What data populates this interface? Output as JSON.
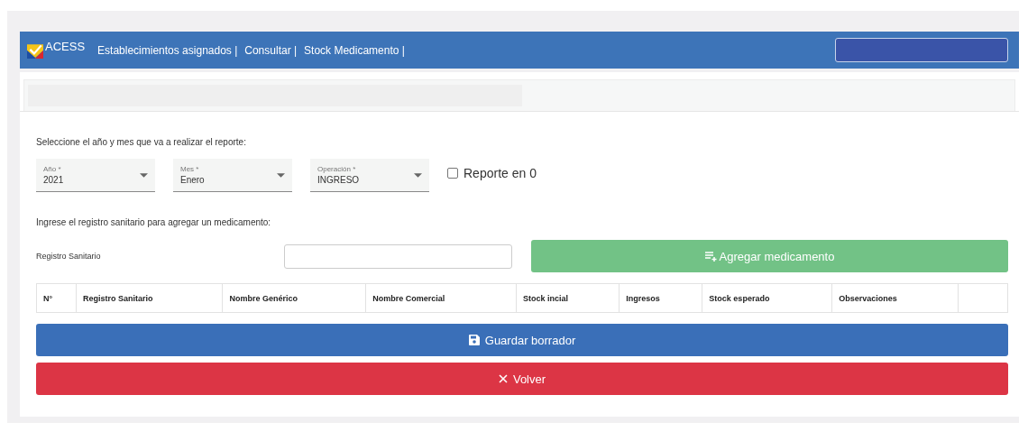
{
  "navbar": {
    "brand": "ACESS",
    "links": [
      "Establecimientos asignados |",
      "Consultar |",
      "Stock Medicamento |"
    ]
  },
  "report_form": {
    "prompt": "Seleccione el año y mes que va a realizar el reporte:",
    "selects": [
      {
        "label": "Año *",
        "value": "2021"
      },
      {
        "label": "Mes *",
        "value": "Enero"
      },
      {
        "label": "Operación *",
        "value": "INGRESO"
      }
    ],
    "zero_report": {
      "label": "Reporte en 0",
      "checked": false
    }
  },
  "medicine_form": {
    "prompt": "Ingrese el registro sanitario para agregar un medicamento:",
    "field_label": "Registro Sanitario",
    "add_button": {
      "label": "Agregar medicamento",
      "disabled": true
    }
  },
  "table": {
    "columns": [
      "N°",
      "Registro Sanitario",
      "Nombre Genérico",
      "Nombre Comercial",
      "Stock incial",
      "Ingresos",
      "Stock esperado",
      "Observaciones"
    ]
  },
  "buttons": [
    {
      "kind": "save",
      "label": "Guardar borrador"
    },
    {
      "kind": "back",
      "label": "Volver"
    }
  ]
}
